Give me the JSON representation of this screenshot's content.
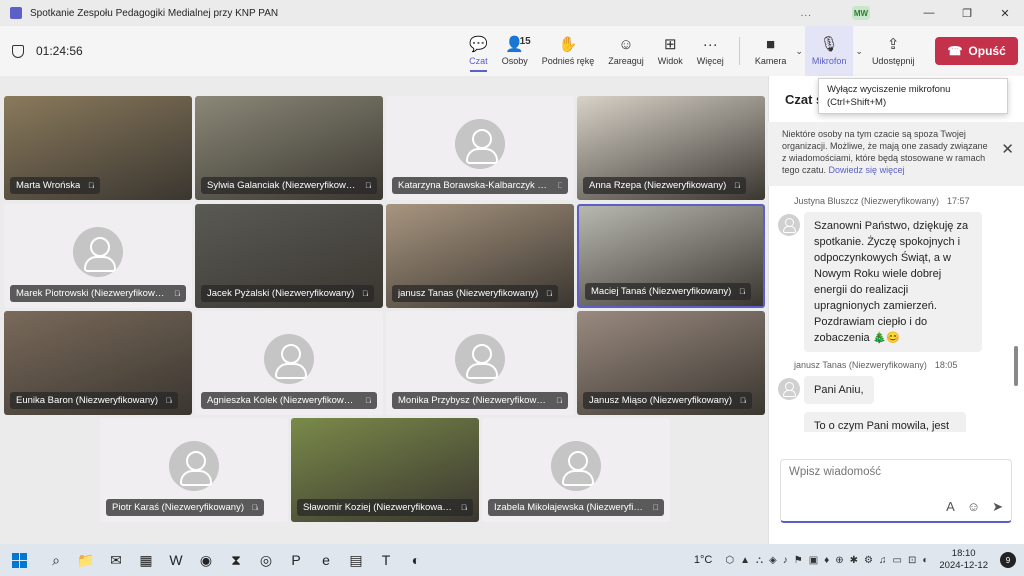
{
  "window": {
    "title": "Spotkanie Zespołu Pedagogiki Medialnej przy KNP PAN",
    "more": "...",
    "avatar": "MW",
    "minimize": "—",
    "restore": "❐",
    "close": "✕"
  },
  "meeting": {
    "elapsed": "01:24:56"
  },
  "toolbar": {
    "chat": "Czat",
    "people": "Osoby",
    "people_count": "15",
    "raise": "Podnieś rękę",
    "react": "Zareaguj",
    "view": "Widok",
    "more": "Więcej",
    "camera": "Kamera",
    "mic": "Mikrofon",
    "share": "Udostępnij",
    "leave": "Opuść"
  },
  "icons": {
    "chat": "💬",
    "people": "👤",
    "raise": "✋",
    "react": "☺",
    "view": "⊞",
    "more": "···",
    "camera": "■",
    "mic": "🎙",
    "share": "⇪",
    "leave": "☎"
  },
  "tooltip": {
    "line1": "Wyłącz wyciszenie mikrofonu",
    "line2": "(Ctrl+Shift+M)"
  },
  "participants": [
    {
      "name": "Marta Wrońska",
      "video": true,
      "bg": "#8a7a5c"
    },
    {
      "name": "Sylwia Galanciak (Niezweryfikowany)",
      "video": true,
      "bg": "#8b8878"
    },
    {
      "name": "Katarzyna Borawska-Kalbarczyk (Niezweryfikowany)",
      "video": false
    },
    {
      "name": "Anna Rzepa (Niezweryfikowany)",
      "video": true,
      "bg": "#d8d2c8"
    },
    {
      "name": "Marek Piotrowski (Niezweryfikowany)",
      "video": false
    },
    {
      "name": "Jacek Pyżalski (Niezweryfikowany)",
      "video": true,
      "bg": "#5a5a55"
    },
    {
      "name": "janusz Tanas (Niezweryfikowany)",
      "video": true,
      "bg": "#a89580"
    },
    {
      "name": "Maciej Tanaś (Niezweryfikowany)",
      "video": true,
      "bg": "#b8b8b0"
    },
    {
      "name": "Eunika Baron (Niezweryfikowany)",
      "video": true,
      "bg": "#7a6a5a"
    },
    {
      "name": "Agnieszka Kolek (Niezweryfikowany)",
      "video": false
    },
    {
      "name": "Monika Przybysz (Niezweryfikowany)",
      "video": false
    },
    {
      "name": "Janusz Miąso (Niezweryfikowany)",
      "video": true,
      "bg": "#9a8a80"
    },
    {
      "name": "Piotr Karaś (Niezweryfikowany)",
      "video": false
    },
    {
      "name": "Sławomir Koziej (Niezweryfikowany)",
      "video": true,
      "bg": "#7a8a4a"
    },
    {
      "name": "Izabela Mikołajewska (Niezweryfikowany)",
      "video": false
    }
  ],
  "chat": {
    "header": "Czat s",
    "notice": "Niektóre osoby na tym czacie są spoza Twojej organizacji. Możliwe, że mają one zasady związane z wiadomościami, które będą stosowane w ramach tego czatu.",
    "notice_link": "Dowiedz się więcej",
    "notice_close": "✕",
    "messages": [
      {
        "author": "Justyna Bluszcz (Niezweryfikowany)",
        "time": "17:57",
        "text": "Szanowni Państwo, dziękuję za spotkanie. Życzę spokojnych i odpoczynkowych Świąt, a w Nowym Roku wiele dobrej energii do realizacji upragnionych zamierzeń. Pozdrawiam ciepło i do zobaczenia 🎄😊"
      },
      {
        "author": "janusz Tanas (Niezweryfikowany)",
        "time": "18:05",
        "text": "Pani Aniu,"
      },
      {
        "text": "To o czym Pani mowila, jest"
      }
    ],
    "compose_placeholder": "Wpisz wiadomość",
    "format_icon": "A",
    "emoji_icon": "☺",
    "send_icon": "➤"
  },
  "taskbar": {
    "apps": [
      "⌕",
      "📁",
      "✉",
      "▦",
      "W",
      "◉",
      "⧗",
      "◎",
      "P",
      "e",
      "▤",
      "T",
      "◐"
    ],
    "weather": "1°C",
    "time": "18:10",
    "date": "2024-12-12",
    "notifications": "9",
    "tray": [
      "⬡",
      "▲",
      "⛬",
      "◈",
      "♪",
      "⚑",
      "▣",
      "♦",
      "⊕",
      "✱",
      "⚙",
      "♫",
      "▭",
      "⊡",
      "◐"
    ]
  }
}
